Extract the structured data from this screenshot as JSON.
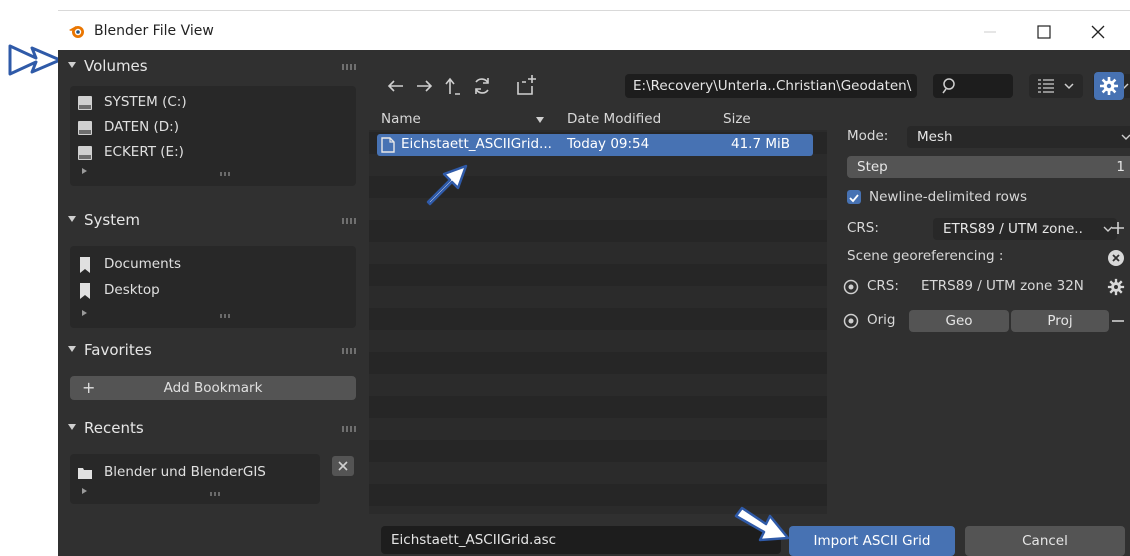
{
  "window": {
    "title": "Blender File View"
  },
  "sidebar": {
    "volumes": {
      "header": "Volumes",
      "items": [
        "SYSTEM (C:)",
        "DATEN (D:)",
        "ECKERT (E:)"
      ]
    },
    "system": {
      "header": "System",
      "items": [
        "Documents",
        "Desktop"
      ]
    },
    "favorites": {
      "header": "Favorites",
      "add_bookmark": "Add Bookmark",
      "add_icon": "+"
    },
    "recents": {
      "header": "Recents",
      "items": [
        "Blender und BlenderGIS"
      ]
    }
  },
  "toolbar": {
    "path": "E:\\Recovery\\Unterla..Christian\\Geodaten\\",
    "icons": [
      "back-arrow-icon",
      "forward-arrow-icon",
      "parent-directory-icon",
      "refresh-icon",
      "new-folder-icon",
      "search-icon",
      "display-mode-icon",
      "filter-icon",
      "gear-icon"
    ]
  },
  "filelist": {
    "columns": {
      "name": "Name",
      "date": "Date Modified",
      "size": "Size"
    },
    "files": [
      {
        "name": "Eichstaett_ASCIIGrid...",
        "date": "Today 09:54",
        "size": "41.7 MiB"
      }
    ]
  },
  "options": {
    "mode_label": "Mode:",
    "mode_value": "Mesh",
    "step_label": "Step",
    "step_value": "1",
    "newline_label": "Newline-delimited rows",
    "newline_checked": true,
    "crs_label": "CRS:",
    "crs_value": "ETRS89 / UTM zone..",
    "scene_georef_label": "Scene georeferencing :",
    "scene_crs_label": "CRS:",
    "scene_crs_value": "ETRS89 / UTM zone 32N",
    "orig_label": "Orig",
    "geo_label": "Geo",
    "proj_label": "Proj"
  },
  "bottom": {
    "filename": "Eichstaett_ASCIIGrid.asc",
    "import_label": "Import ASCII Grid",
    "cancel_label": "Cancel"
  },
  "colors": {
    "accent": "#4772b3",
    "panel": "#303030",
    "field": "#1d1d1d",
    "annotation_arrow": "#2f5aa8"
  }
}
